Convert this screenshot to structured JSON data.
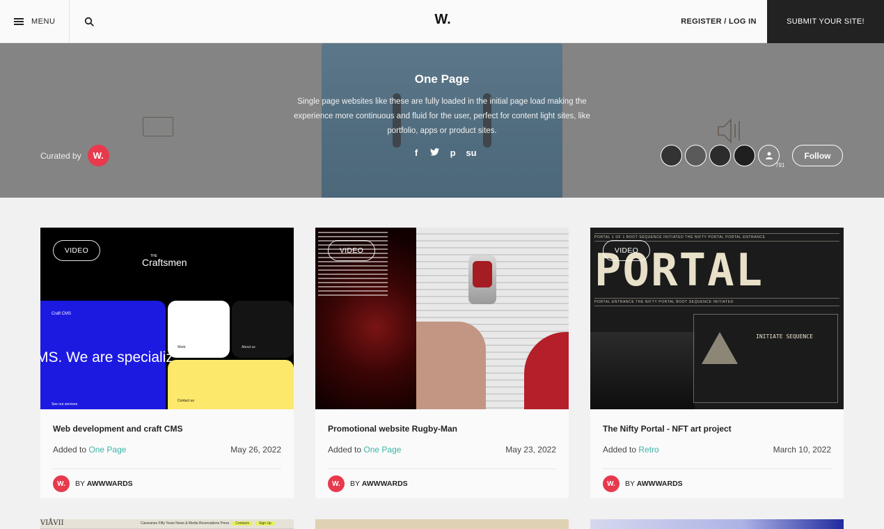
{
  "header": {
    "menu_label": "MENU",
    "logo": "W.",
    "login": "REGISTER / LOG IN",
    "submit": "SUBMIT YOUR SITE!"
  },
  "hero": {
    "title": "One Page",
    "description": "Single page websites like these are fully loaded in the initial page load making the experience more continuous and fluid for the user, perfect for content light sites, like portfolio, apps or product sites.",
    "curated_label": "Curated by",
    "curator_badge": "W.",
    "social": [
      "f",
      "t",
      "p",
      "su"
    ],
    "followers_count": "791",
    "follow_label": "Follow"
  },
  "cards": [
    {
      "badge": "VIDEO",
      "title": "Web development and craft CMS",
      "added_prefix": "Added to",
      "category": "One Page",
      "date": "May 26, 2022",
      "author_badge": "W.",
      "author_prefix": "BY",
      "author": "AWWWARDS",
      "thumb": {
        "brand_small": "THE",
        "brand": "Craftsmen",
        "blue_label": "Craft CMS",
        "blue_text": "MS. We are specializ",
        "blue_foot": "See our services",
        "white_label": "Work",
        "dark_label": "About us",
        "yellow_label": "Contact us"
      }
    },
    {
      "badge": "VIDEO",
      "title": "Promotional website Rugby-Man",
      "added_prefix": "Added to",
      "category": "One Page",
      "date": "May 23, 2022",
      "author_badge": "W.",
      "author_prefix": "BY",
      "author": "AWWWARDS"
    },
    {
      "badge": "VIDEO",
      "title": "The Nifty Portal - NFT art project",
      "added_prefix": "Added to",
      "category": "Retro",
      "date": "March 10, 2022",
      "author_badge": "W.",
      "author_prefix": "BY",
      "author": "AWWWARDS",
      "thumb": {
        "ticker_top": "PORTAL 1 OF 1   BOOT SEQUENCE INITIATED   THE NIFTY PORTAL   PORTAL ENTRANCE",
        "portal": "PORTAL",
        "ticker_mid": "PORTAL ENTRANCE   THE NIFTY PORTAL   BOOT SEQUENCE INITIATED",
        "init": "INITIATE SEQUENCE"
      }
    }
  ],
  "peek": {
    "logo": "VIÅVII",
    "nav": "Caravanes   Fifty Years   News & Media   Reservations   Press",
    "pill1": "Contacts",
    "pill2": "Sign Up"
  }
}
